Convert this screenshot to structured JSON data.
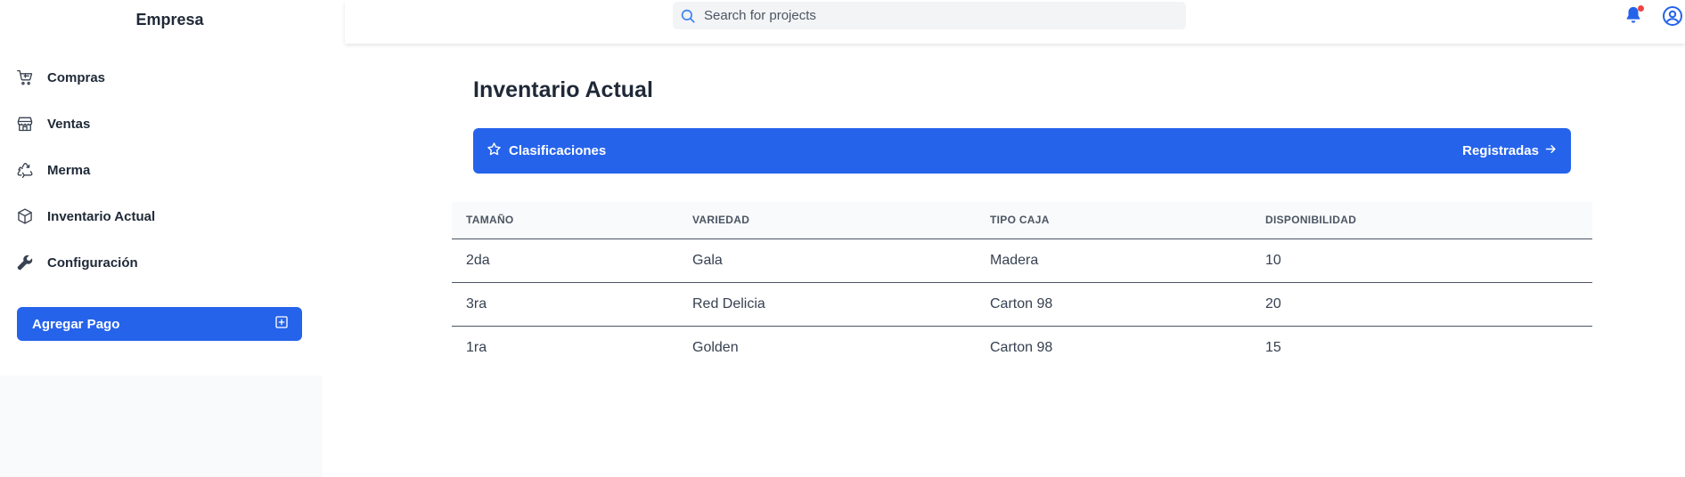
{
  "brand": {
    "name": "Empresa"
  },
  "sidebar": {
    "items": [
      {
        "label": "Compras",
        "icon": "cart-icon"
      },
      {
        "label": "Ventas",
        "icon": "store-icon"
      },
      {
        "label": "Merma",
        "icon": "recycle-icon"
      },
      {
        "label": "Inventario Actual",
        "icon": "box-icon"
      },
      {
        "label": "Configuración",
        "icon": "wrench-icon"
      }
    ],
    "action_button": {
      "label": "Agregar Pago",
      "icon": "plus-square-icon"
    }
  },
  "header": {
    "search": {
      "placeholder": "Search for projects",
      "value": ""
    },
    "notifications": {
      "icon": "bell-icon",
      "has_unread": true
    },
    "user": {
      "icon": "user-circle-icon"
    }
  },
  "main": {
    "title": "Inventario Actual",
    "banner": {
      "left_label": "Clasificaciones",
      "right_label": "Registradas"
    },
    "table": {
      "columns": [
        "TAMAÑO",
        "VARIEDAD",
        "TIPO CAJA",
        "DISPONIBILIDAD"
      ],
      "rows": [
        [
          "2da",
          "Gala",
          "Madera",
          "10"
        ],
        [
          "3ra",
          "Red Delicia",
          "Carton 98",
          "20"
        ],
        [
          "1ra",
          "Golden",
          "Carton 98",
          "15"
        ]
      ]
    }
  },
  "colors": {
    "accent": "#2563eb",
    "notification_dot": "#ef4444",
    "sidebar_bottom": "#f9fafb"
  }
}
